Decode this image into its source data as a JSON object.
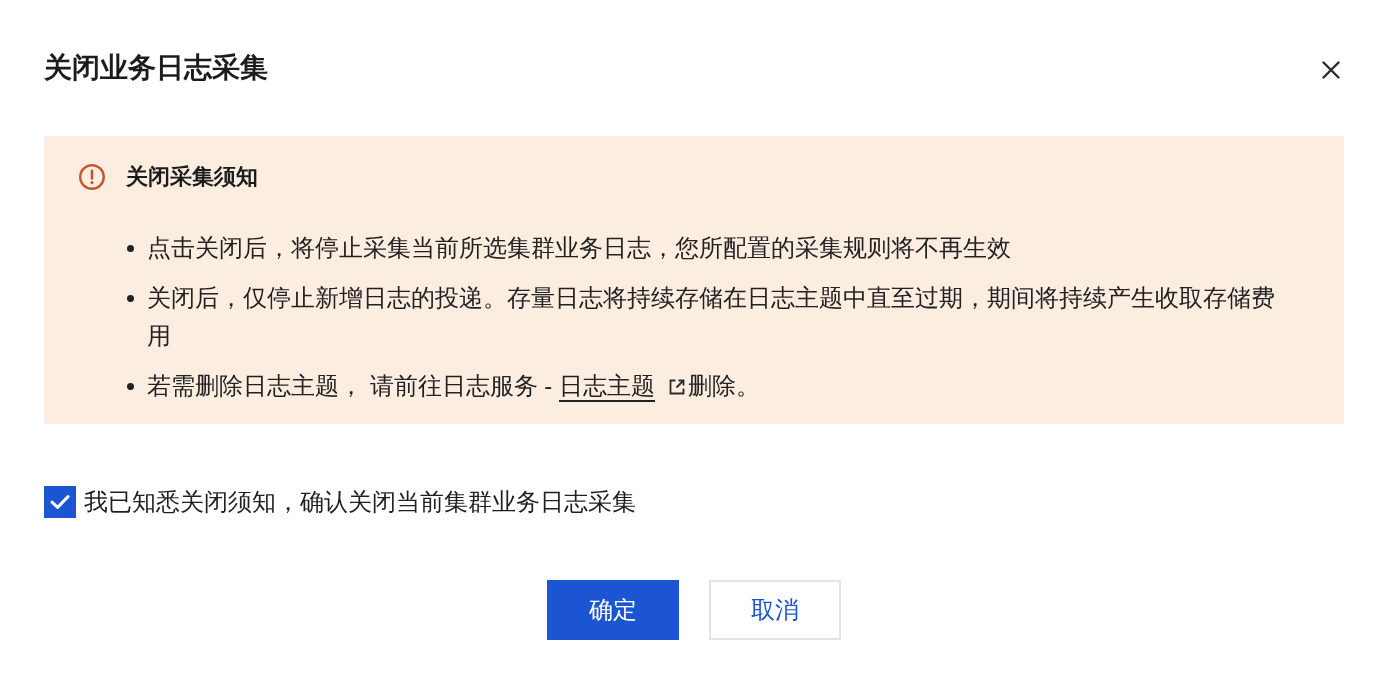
{
  "dialog": {
    "title": "关闭业务日志采集"
  },
  "notice": {
    "title": "关闭采集须知",
    "items": [
      {
        "kind": "text",
        "text": "点击关闭后，将停止采集当前所选集群业务日志，您所配置的采集规则将不再生效"
      },
      {
        "kind": "text",
        "text": "关闭后，仅停止新增日志的投递。存量日志将持续存储在日志主题中直至过期，期间将持续产生收取存储费用"
      },
      {
        "kind": "link",
        "before": "若需删除日志主题， 请前往日志服务 - ",
        "link": "日志主题",
        "after": "删除。"
      }
    ]
  },
  "confirm": {
    "label": "我已知悉关闭须知，确认关闭当前集群业务日志采集",
    "checked": true
  },
  "buttons": [
    {
      "label": "确定",
      "kind": "primary"
    },
    {
      "label": "取消",
      "kind": "secondary"
    }
  ]
}
